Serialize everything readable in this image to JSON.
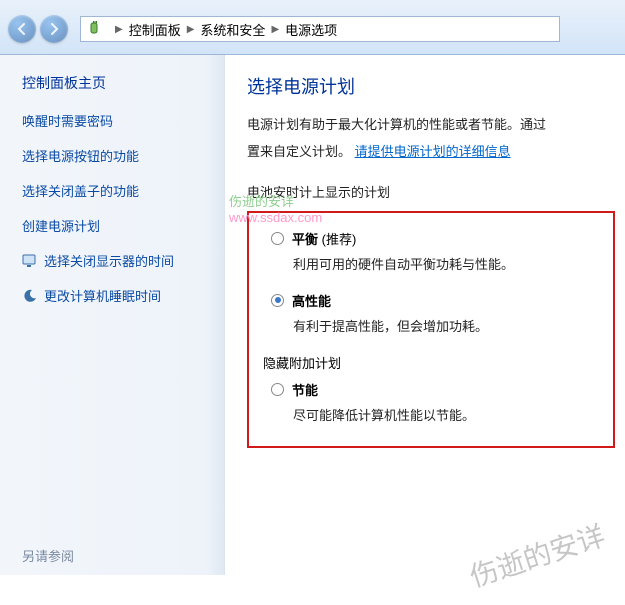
{
  "breadcrumb": {
    "items": [
      "控制面板",
      "系统和安全",
      "电源选项"
    ]
  },
  "sidebar": {
    "title": "控制面板主页",
    "links": [
      {
        "label": "唤醒时需要密码",
        "icon": null
      },
      {
        "label": "选择电源按钮的功能",
        "icon": null
      },
      {
        "label": "选择关闭盖子的功能",
        "icon": null
      },
      {
        "label": "创建电源计划",
        "icon": null
      },
      {
        "label": "选择关闭显示器的时间",
        "icon": "monitor"
      },
      {
        "label": "更改计算机睡眠时间",
        "icon": "moon"
      }
    ],
    "see_also": "另请参阅"
  },
  "main": {
    "title": "选择电源计划",
    "description_prefix": "电源计划有助于最大化计算机的性能或者节能。通过",
    "description_line2_prefix": "置来自定义计划。",
    "more_info_link": "请提供电源计划的详细信息",
    "section_shown": "电池安时计上显示的计划",
    "plans_shown": [
      {
        "name": "平衡",
        "suffix": " (推荐)",
        "desc": "利用可用的硬件自动平衡功耗与性能。",
        "selected": false
      },
      {
        "name": "高性能",
        "suffix": "",
        "desc": "有利于提高性能，但会增加功耗。",
        "selected": true
      }
    ],
    "section_hidden": "隐藏附加计划",
    "plans_hidden": [
      {
        "name": "节能",
        "suffix": "",
        "desc": "尽可能降低计算机性能以节能。",
        "selected": false
      }
    ]
  },
  "watermark1_a": "伤逝的安详",
  "watermark1_b": "www.ssdax.com",
  "watermark2": "伤逝的安详"
}
